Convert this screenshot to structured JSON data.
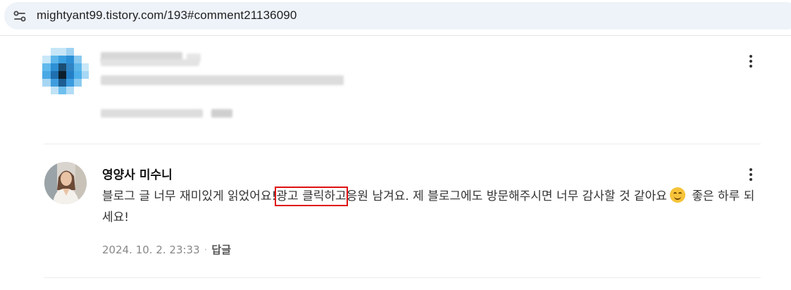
{
  "browser": {
    "url": "mightyant99.tistory.com/193#comment21136090",
    "site_icon": "tune-icon"
  },
  "comment_blurred": {
    "avatar_icon": "pixelated-avatar",
    "more_icon": "more-vertical-icon"
  },
  "comment": {
    "author": "영양사 미수니",
    "text_before": "블로그 글 너무 재미있게 읽었어요!",
    "text_highlight": "광고 클릭하고",
    "text_after": "응원 남겨요. 제 블로그에도 방문해주시면 너무 감사할 것 같아요",
    "text_end": " 좋은 하루 되세요!",
    "emoji": "smiling-face-emoji",
    "date": "2024. 10. 2. 23:33",
    "separator": "·",
    "reply_label": "답글",
    "more_icon": "more-vertical-icon",
    "highlight_color": "#e01010"
  }
}
